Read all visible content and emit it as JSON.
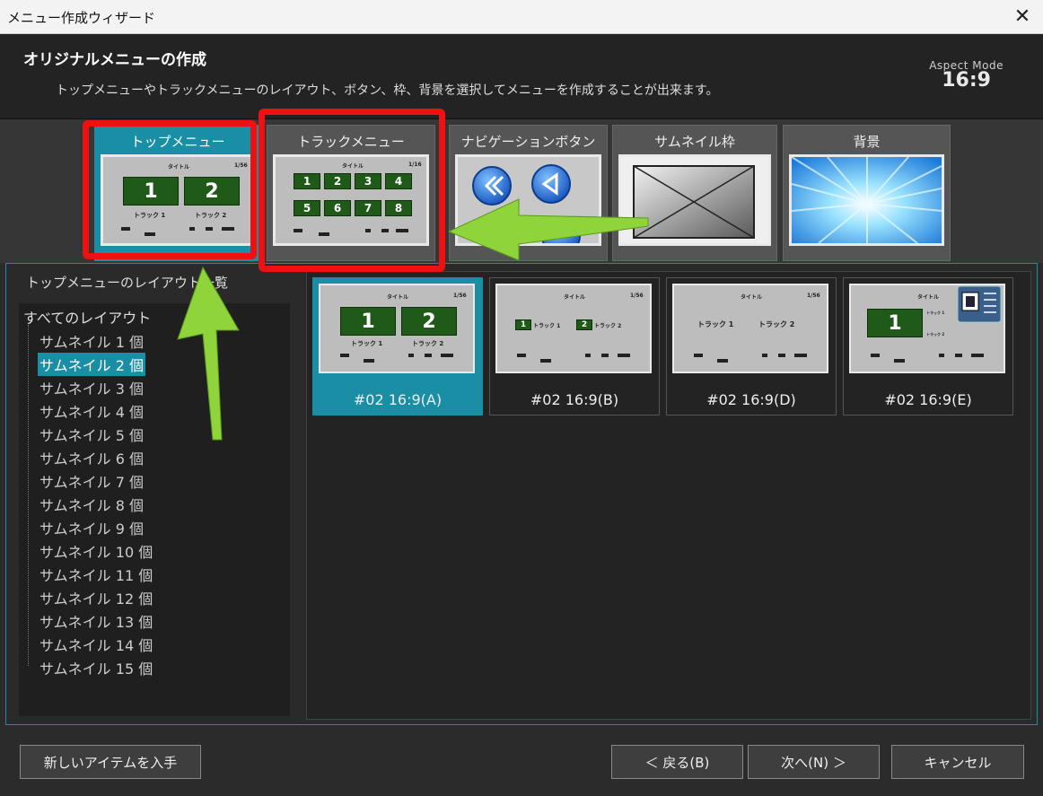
{
  "window": {
    "title": "メニュー作成ウィザード"
  },
  "header": {
    "title": "オリジナルメニューの作成",
    "description": "トップメニューやトラックメニューのレイアウト、ボタン、枠、背景を選択してメニューを作成することが出来ます。",
    "aspect_label": "Aspect Mode",
    "aspect_value": "16:9"
  },
  "tabs": [
    {
      "label": "トップメニュー"
    },
    {
      "label": "トラックメニュー"
    },
    {
      "label": "ナビゲーションボタン"
    },
    {
      "label": "サムネイル枠"
    },
    {
      "label": "背景"
    }
  ],
  "thumb_text": {
    "title": "タイトル",
    "page": "1/56",
    "page2": "1/16",
    "track1": "トラック 1",
    "track2": "トラック 2",
    "n1": "1",
    "n2": "2",
    "n3": "3",
    "n4": "4",
    "n5": "5",
    "n6": "6",
    "n7": "7",
    "n8": "8"
  },
  "layout_panel": {
    "title": "トップメニューのレイアウト一覧",
    "root": "すべてのレイアウト",
    "items": [
      "サムネイル 1 個",
      "サムネイル 2 個",
      "サムネイル 3 個",
      "サムネイル 4 個",
      "サムネイル 5 個",
      "サムネイル 6 個",
      "サムネイル 7 個",
      "サムネイル 8 個",
      "サムネイル 9 個",
      "サムネイル 10 個",
      "サムネイル 11 個",
      "サムネイル 12 個",
      "サムネイル 13 個",
      "サムネイル 14 個",
      "サムネイル 15 個"
    ],
    "selected": "サムネイル 2 個"
  },
  "layouts": [
    {
      "label": "#02 16:9(A)"
    },
    {
      "label": "#02 16:9(B)"
    },
    {
      "label": "#02 16:9(D)"
    },
    {
      "label": "#02 16:9(E)"
    }
  ],
  "buttons": {
    "get_items": "新しいアイテムを入手",
    "back": "＜ 戻る(B)",
    "next": "次へ(N) ＞",
    "cancel": "キャンセル"
  },
  "colors": {
    "accent": "#1a8ea5",
    "highlight": "#ee1111",
    "arrow": "#8ed43a"
  }
}
